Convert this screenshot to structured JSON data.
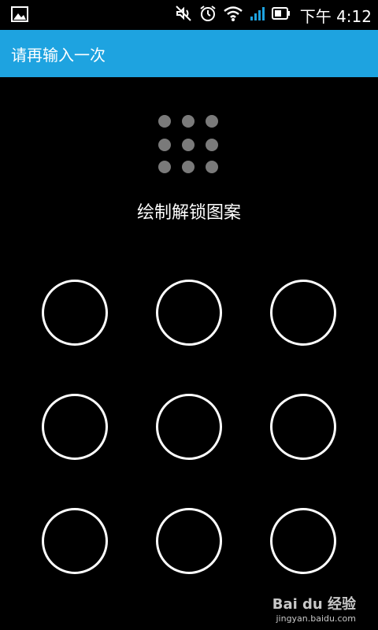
{
  "status_bar": {
    "left_icon": "gallery-icon",
    "icons": [
      "mute-icon",
      "alarm-icon",
      "wifi-icon",
      "signal-icon",
      "battery-icon"
    ],
    "time": "下午 4:12",
    "signal_color": "#1ea3e0"
  },
  "action_bar": {
    "title": "请再输入一次",
    "color": "#1ea3e0"
  },
  "preview": {
    "dot_count": 9,
    "dot_color": "#7a7a7a"
  },
  "hint": "绘制解锁图案",
  "pattern": {
    "nodes": [
      "1",
      "2",
      "3",
      "4",
      "5",
      "6",
      "7",
      "8",
      "9"
    ]
  },
  "watermark": {
    "brand": "Bai du 经验",
    "url": "jingyan.baidu.com"
  }
}
